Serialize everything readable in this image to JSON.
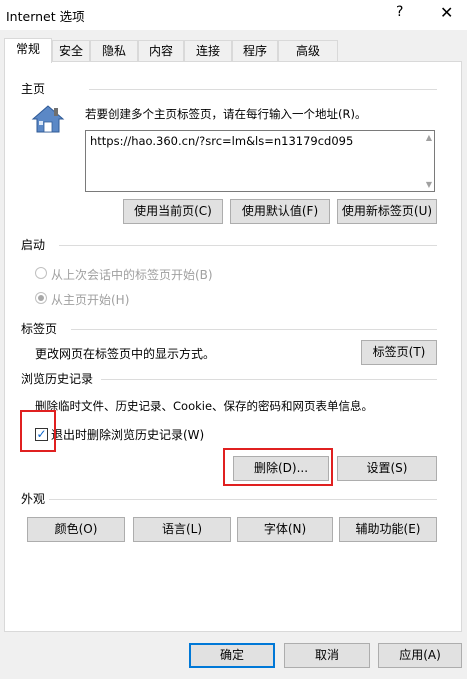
{
  "window": {
    "title": "Internet 选项",
    "help": "?",
    "close": "✕"
  },
  "tabs": [
    "常规",
    "安全",
    "隐私",
    "内容",
    "连接",
    "程序",
    "高级"
  ],
  "homepage": {
    "group": "主页",
    "hint": "若要创建多个主页标签页，请在每行输入一个地址(R)。",
    "url": "https://hao.360.cn/?src=lm&ls=n13179cd095",
    "buttons": [
      "使用当前页(C)",
      "使用默认值(F)",
      "使用新标签页(U)"
    ]
  },
  "startup": {
    "group": "启动",
    "option_last": "从上次会话中的标签页开始(B)",
    "option_home": "从主页开始(H)"
  },
  "tabs_group": {
    "group": "标签页",
    "desc": "更改网页在标签页中的显示方式。",
    "button": "标签页(T)"
  },
  "history": {
    "group": "浏览历史记录",
    "desc": "删除临时文件、历史记录、Cookie、保存的密码和网页表单信息。",
    "checkbox": "退出时删除浏览历史记录(W)",
    "checked": true,
    "delete_button": "删除(D)...",
    "settings_button": "设置(S)"
  },
  "appearance": {
    "group": "外观",
    "buttons": [
      "颜色(O)",
      "语言(L)",
      "字体(N)",
      "辅助功能(E)"
    ]
  },
  "footer": {
    "ok": "确定",
    "cancel": "取消",
    "apply": "应用(A)"
  },
  "colors": {
    "highlight": "#e02020",
    "accent": "#0078d7"
  },
  "icons": {
    "home": "house-icon"
  }
}
